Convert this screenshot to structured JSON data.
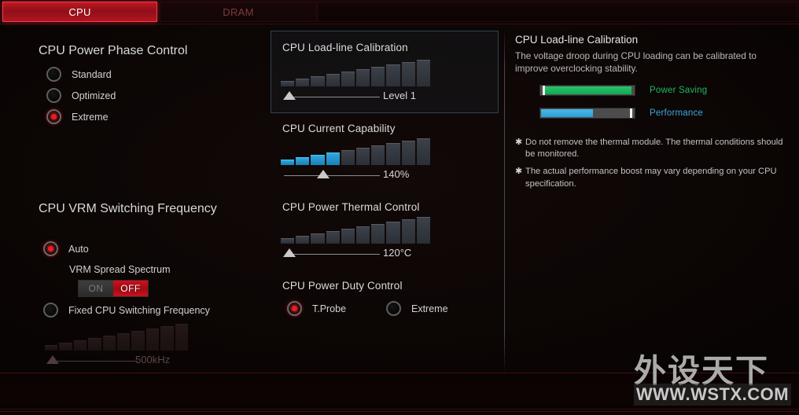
{
  "tabs": [
    {
      "label": "CPU",
      "active": true
    },
    {
      "label": "DRAM",
      "active": false
    }
  ],
  "left_column": {
    "power_phase": {
      "title": "CPU Power Phase Control",
      "options": [
        {
          "label": "Standard",
          "selected": false
        },
        {
          "label": "Optimized",
          "selected": false
        },
        {
          "label": "Extreme",
          "selected": true
        }
      ]
    },
    "vrm": {
      "title": "CPU VRM Switching Frequency",
      "auto_label": "Auto",
      "auto_selected": true,
      "spread_spectrum_label": "VRM Spread Spectrum",
      "toggle_on_label": "ON",
      "toggle_off_label": "OFF",
      "toggle_value": "OFF",
      "fixed_label": "Fixed CPU Switching Frequency",
      "fixed_selected": false,
      "frequency_value": "500kHz",
      "frequency_disabled": true
    }
  },
  "middle_column": {
    "loadline": {
      "title": "CPU Load-line Calibration",
      "value": "Level 1",
      "focused": true
    },
    "current_capability": {
      "title": "CPU Current Capability",
      "value": "140%"
    },
    "thermal_control": {
      "title": "CPU Power Thermal Control",
      "value": "120°C"
    },
    "duty_control": {
      "title": "CPU Power Duty Control",
      "options": [
        {
          "label": "T.Probe",
          "selected": true
        },
        {
          "label": "Extreme",
          "selected": false
        }
      ]
    }
  },
  "help_panel": {
    "title": "CPU Load-line Calibration",
    "description": "The voltage droop during CPU loading can be calibrated to improve overclocking stability.",
    "meters": [
      {
        "label": "Power Saving",
        "color": "#1fb85f",
        "percent": 92
      },
      {
        "label": "Performance",
        "color": "#3aa8de",
        "percent": 55
      }
    ],
    "notes": [
      {
        "star": "✱",
        "text": "Do not remove the thermal module. The thermal conditions should be monitored."
      },
      {
        "star": "✱",
        "text": "The actual performance boost may vary depending on your CPU specification."
      }
    ]
  },
  "watermark": {
    "cjk": "外设天下",
    "url": "WWW.WSTX.COM"
  },
  "colors": {
    "accent_red": "#c01824",
    "accent_blue": "#2fa8e0",
    "accent_green": "#1fb85f",
    "background": "#0c0605"
  }
}
